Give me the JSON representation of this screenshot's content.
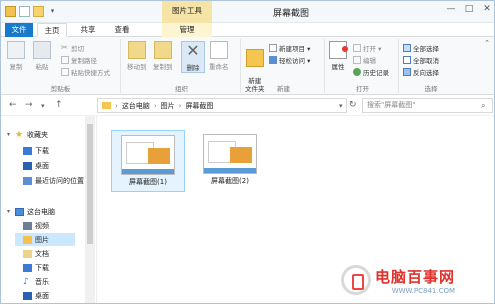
{
  "window": {
    "title": "屏幕截图",
    "context_tab_group": "图片工具",
    "minimize_icon": "minimize-icon",
    "maximize_icon": "maximize-icon",
    "close_icon": "close-icon"
  },
  "tabs": [
    "文件",
    "主页",
    "共享",
    "查看",
    "管理"
  ],
  "ribbon": {
    "clipboard": {
      "copy": "复制",
      "paste": "粘贴",
      "cut": "剪切",
      "copy_path": "复制路径",
      "paste_shortcut": "粘贴快捷方式",
      "label": "剪贴板"
    },
    "organize": {
      "move_to": "移动到",
      "copy_to": "复制到",
      "delete": "删除",
      "rename": "重命名",
      "label": "组织"
    },
    "new": {
      "new_folder": "新建\n文件夹",
      "new_item": "新建项目 ▾",
      "easy_access": "轻松访问 ▾",
      "label": "新建"
    },
    "open": {
      "properties": "属性",
      "open": "打开 ▾",
      "edit": "编辑",
      "history": "历史记录",
      "label": "打开"
    },
    "select": {
      "select_all": "全部选择",
      "select_none": "全部取消",
      "invert": "反向选择",
      "label": "选择"
    }
  },
  "address": {
    "path": [
      "这台电脑",
      "图片",
      "屏幕截图"
    ],
    "search_placeholder": "搜索\"屏幕截图\""
  },
  "nav": {
    "favorites": "收藏夹",
    "download": "下载",
    "desktop": "桌面",
    "recent": "最近访问的位置",
    "this_pc": "这台电脑",
    "video": "视频",
    "pictures": "图片",
    "documents": "文档",
    "downloads2": "下载",
    "music": "音乐",
    "desktop2": "桌面"
  },
  "files": [
    {
      "name": "屏幕截图(1)"
    },
    {
      "name": "屏幕截图(2)"
    }
  ],
  "watermark": {
    "title": "电脑百事网",
    "url": "WWW.PC841.COM"
  },
  "colors": {
    "file_tab": "#1979ca",
    "context_tab": "#f6e4a7",
    "selection": "#cce8ff",
    "watermark_red": "#e0312b"
  }
}
